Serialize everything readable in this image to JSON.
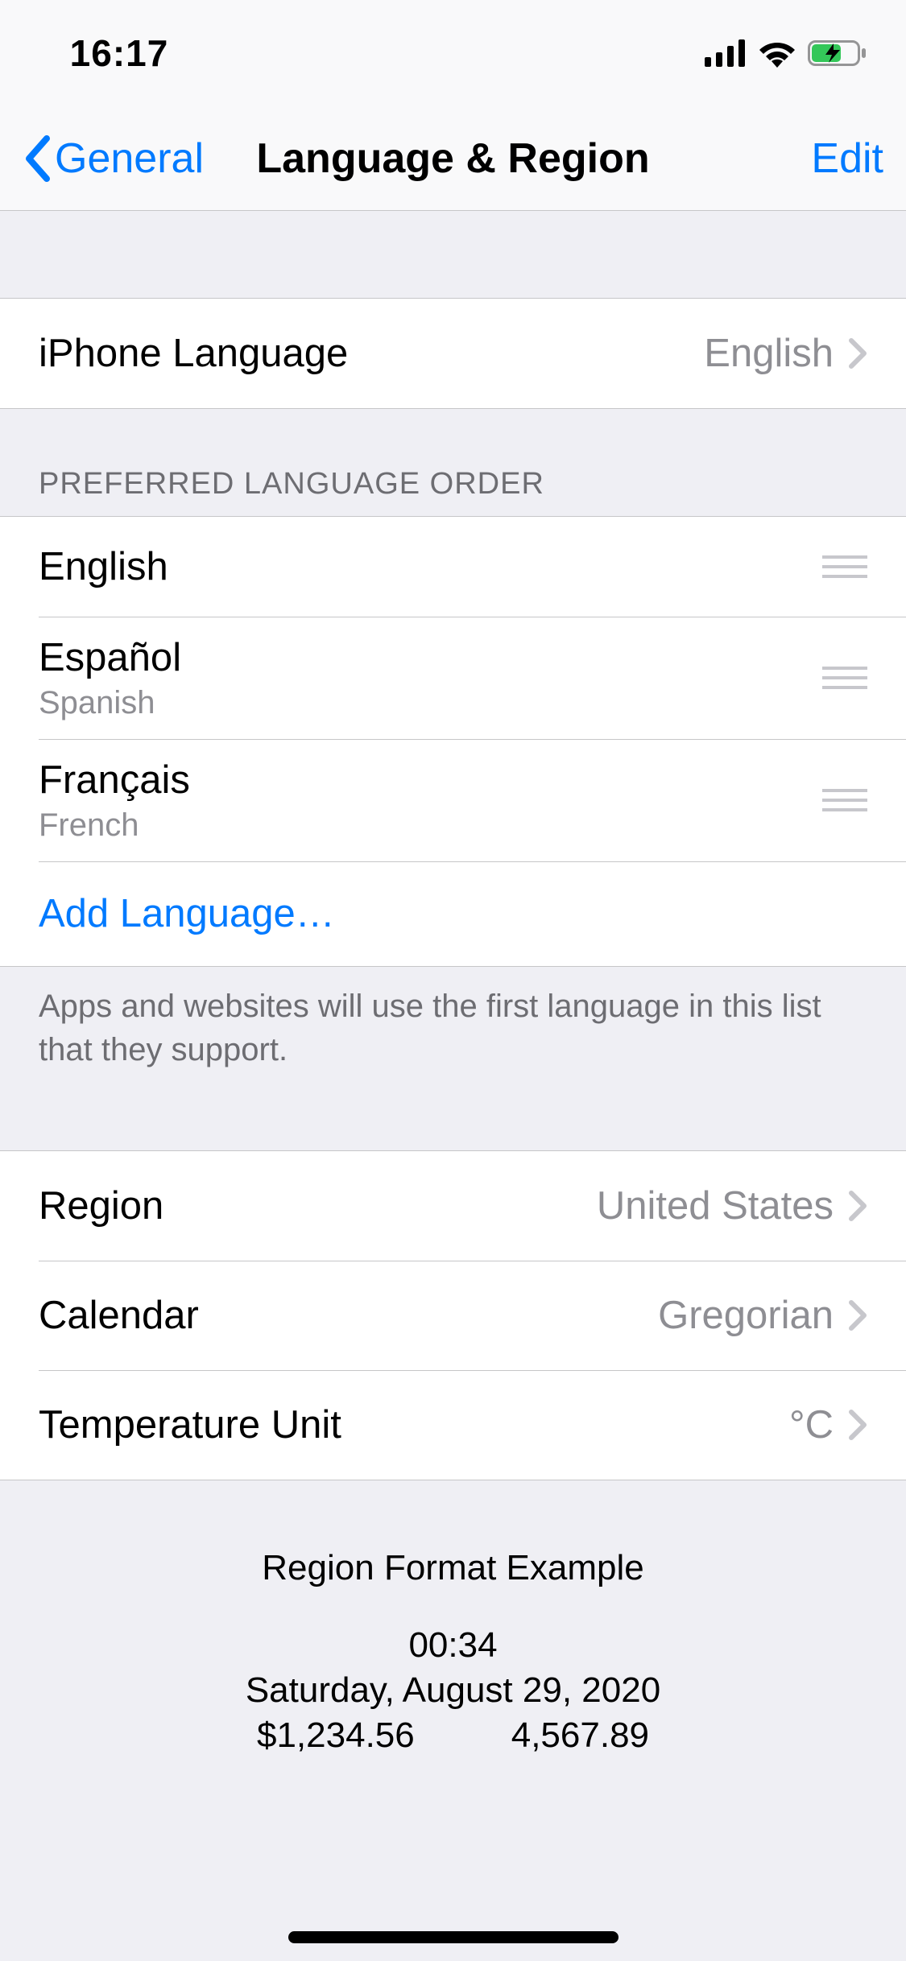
{
  "status": {
    "time": "16:17"
  },
  "nav": {
    "back_label": "General",
    "title": "Language & Region",
    "edit_label": "Edit"
  },
  "iphone_language": {
    "label": "iPhone Language",
    "value": "English"
  },
  "preferred_header": "PREFERRED LANGUAGE ORDER",
  "languages": [
    {
      "name": "English",
      "sub": ""
    },
    {
      "name": "Español",
      "sub": "Spanish"
    },
    {
      "name": "Français",
      "sub": "French"
    }
  ],
  "add_language_label": "Add Language…",
  "preferred_footer": "Apps and websites will use the first language in this list that they support.",
  "region": {
    "label": "Region",
    "value": "United States"
  },
  "calendar": {
    "label": "Calendar",
    "value": "Gregorian"
  },
  "temperature": {
    "label": "Temperature Unit",
    "value": "°C"
  },
  "example": {
    "title": "Region Format Example",
    "time": "00:34",
    "date": "Saturday, August 29, 2020",
    "num1": "$1,234.56",
    "num2": "4,567.89"
  }
}
